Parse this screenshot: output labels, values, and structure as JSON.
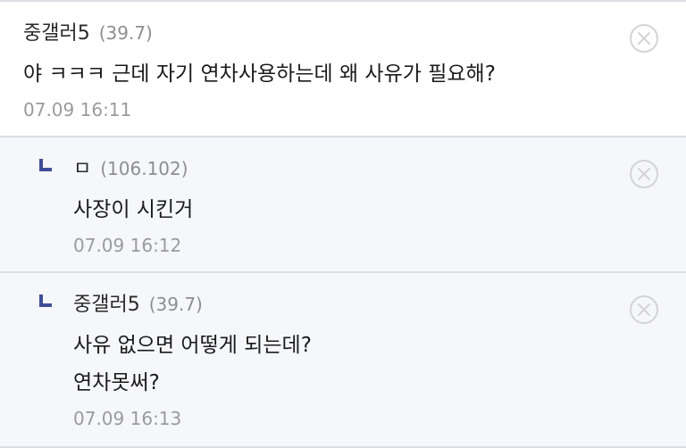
{
  "comments": [
    {
      "nick": "중갤러5",
      "ip": "(39.7)",
      "lines": [
        "야 ㅋㅋㅋ 근데 자기 연차사용하는데 왜 사유가 필요해?"
      ],
      "time": "07.09 16:11"
    },
    {
      "nick": "ㅁ",
      "ip": "(106.102)",
      "lines": [
        "사장이 시킨거"
      ],
      "time": "07.09 16:12"
    },
    {
      "nick": "중갤러5",
      "ip": "(39.7)",
      "lines": [
        "사유 없으면 어떻게 되는데?",
        "연차못써?"
      ],
      "time": "07.09 16:13"
    }
  ],
  "icons": {
    "delete": "close-circle-icon",
    "reply": "reply-corner-icon"
  },
  "colors": {
    "reply_accent": "#3f4d98",
    "reply_background": "#f6f7fb",
    "divider": "#dcdde6",
    "meta_gray": "#9b9b9b"
  }
}
